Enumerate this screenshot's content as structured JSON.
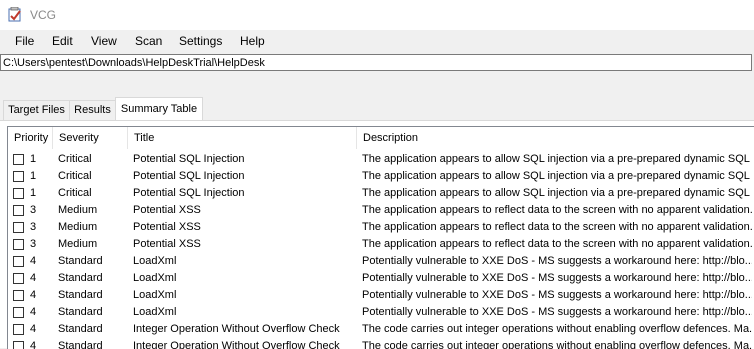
{
  "window": {
    "title": "VCG"
  },
  "menu": [
    "File",
    "Edit",
    "View",
    "Scan",
    "Settings",
    "Help"
  ],
  "path": "C:\\Users\\pentest\\Downloads\\HelpDeskTrial\\HelpDesk",
  "tabs": [
    "Target Files",
    "Results",
    "Summary Table"
  ],
  "table": {
    "headers": [
      "Priority",
      "Severity",
      "Title",
      "Description"
    ],
    "rows": [
      {
        "priority": "1",
        "severity": "Critical",
        "title": "Potential SQL Injection",
        "description": "The application appears to allow SQL injection via a pre-prepared dynamic SQL ..."
      },
      {
        "priority": "1",
        "severity": "Critical",
        "title": "Potential SQL Injection",
        "description": "The application appears to allow SQL injection via a pre-prepared dynamic SQL ..."
      },
      {
        "priority": "1",
        "severity": "Critical",
        "title": "Potential SQL Injection",
        "description": "The application appears to allow SQL injection via a pre-prepared dynamic SQL ..."
      },
      {
        "priority": "3",
        "severity": "Medium",
        "title": "Potential XSS",
        "description": "The application appears to reflect data to the screen with no apparent validation..."
      },
      {
        "priority": "3",
        "severity": "Medium",
        "title": "Potential XSS",
        "description": "The application appears to reflect data to the screen with no apparent validation..."
      },
      {
        "priority": "3",
        "severity": "Medium",
        "title": "Potential XSS",
        "description": "The application appears to reflect data to the screen with no apparent validation..."
      },
      {
        "priority": "4",
        "severity": "Standard",
        "title": "LoadXml",
        "description": "Potentially vulnerable to XXE DoS - MS suggests a workaround here: http://blo..."
      },
      {
        "priority": "4",
        "severity": "Standard",
        "title": "LoadXml",
        "description": "Potentially vulnerable to XXE DoS - MS suggests a workaround here: http://blo..."
      },
      {
        "priority": "4",
        "severity": "Standard",
        "title": "LoadXml",
        "description": "Potentially vulnerable to XXE DoS - MS suggests a workaround here: http://blo..."
      },
      {
        "priority": "4",
        "severity": "Standard",
        "title": "LoadXml",
        "description": "Potentially vulnerable to XXE DoS - MS suggests a workaround here: http://blo..."
      },
      {
        "priority": "4",
        "severity": "Standard",
        "title": "Integer Operation Without Overflow Check",
        "description": "The code carries out integer operations without enabling overflow defences. Ma..."
      },
      {
        "priority": "4",
        "severity": "Standard",
        "title": "Integer Operation Without Overflow Check",
        "description": "The code carries out integer operations without enabling overflow defences. Ma..."
      }
    ]
  }
}
